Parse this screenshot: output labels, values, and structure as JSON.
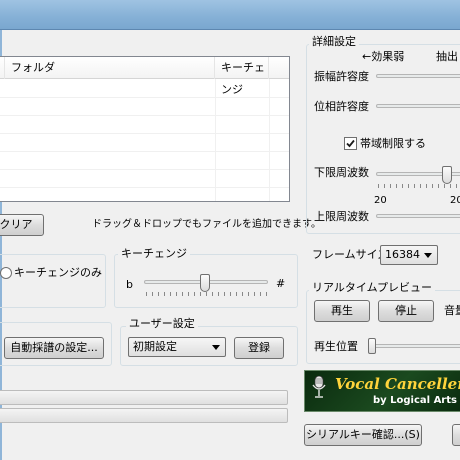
{
  "file_list": {
    "columns": [
      "フォルダ",
      "キーチェンジ"
    ]
  },
  "clear_button": "クリア",
  "drag_drop_hint": "ドラッグ＆ドロップでもファイルを追加できます。",
  "key_change_only_option": "キーチェンジのみ",
  "key_change": {
    "group_title": "キーチェンジ",
    "flat_symbol": "b",
    "sharp_symbol": "#"
  },
  "auto_transcribe_button": "自動採譜の設定...",
  "user_settings": {
    "group_title": "ユーザー設定",
    "preset_value": "初期設定",
    "register_button": "登録"
  },
  "advanced": {
    "title": "詳細設定",
    "effect_weak": "←効果弱",
    "extract_label": "抽出",
    "amplitude_tolerance": "振幅許容度",
    "phase_tolerance": "位相許容度",
    "band_limit_checkbox": "帯域制限する",
    "band_limit_checked": true,
    "lower_freq": "下限周波数",
    "lower_freq_tick": "20",
    "lower_freq_tick_right": "20",
    "upper_freq": "上限周波数",
    "frame_size_label": "フレームサイズ",
    "frame_size_value": "16384"
  },
  "realtime_preview": {
    "group_title": "リアルタイムプレビュー",
    "play_button": "再生",
    "stop_button": "停止",
    "volume_label": "音量",
    "position_label": "再生位置"
  },
  "logo": {
    "main": "Vocal Canceller",
    "sub": "by Logical Arts"
  },
  "serial_key_button": "シリアルキー確認...(S)"
}
